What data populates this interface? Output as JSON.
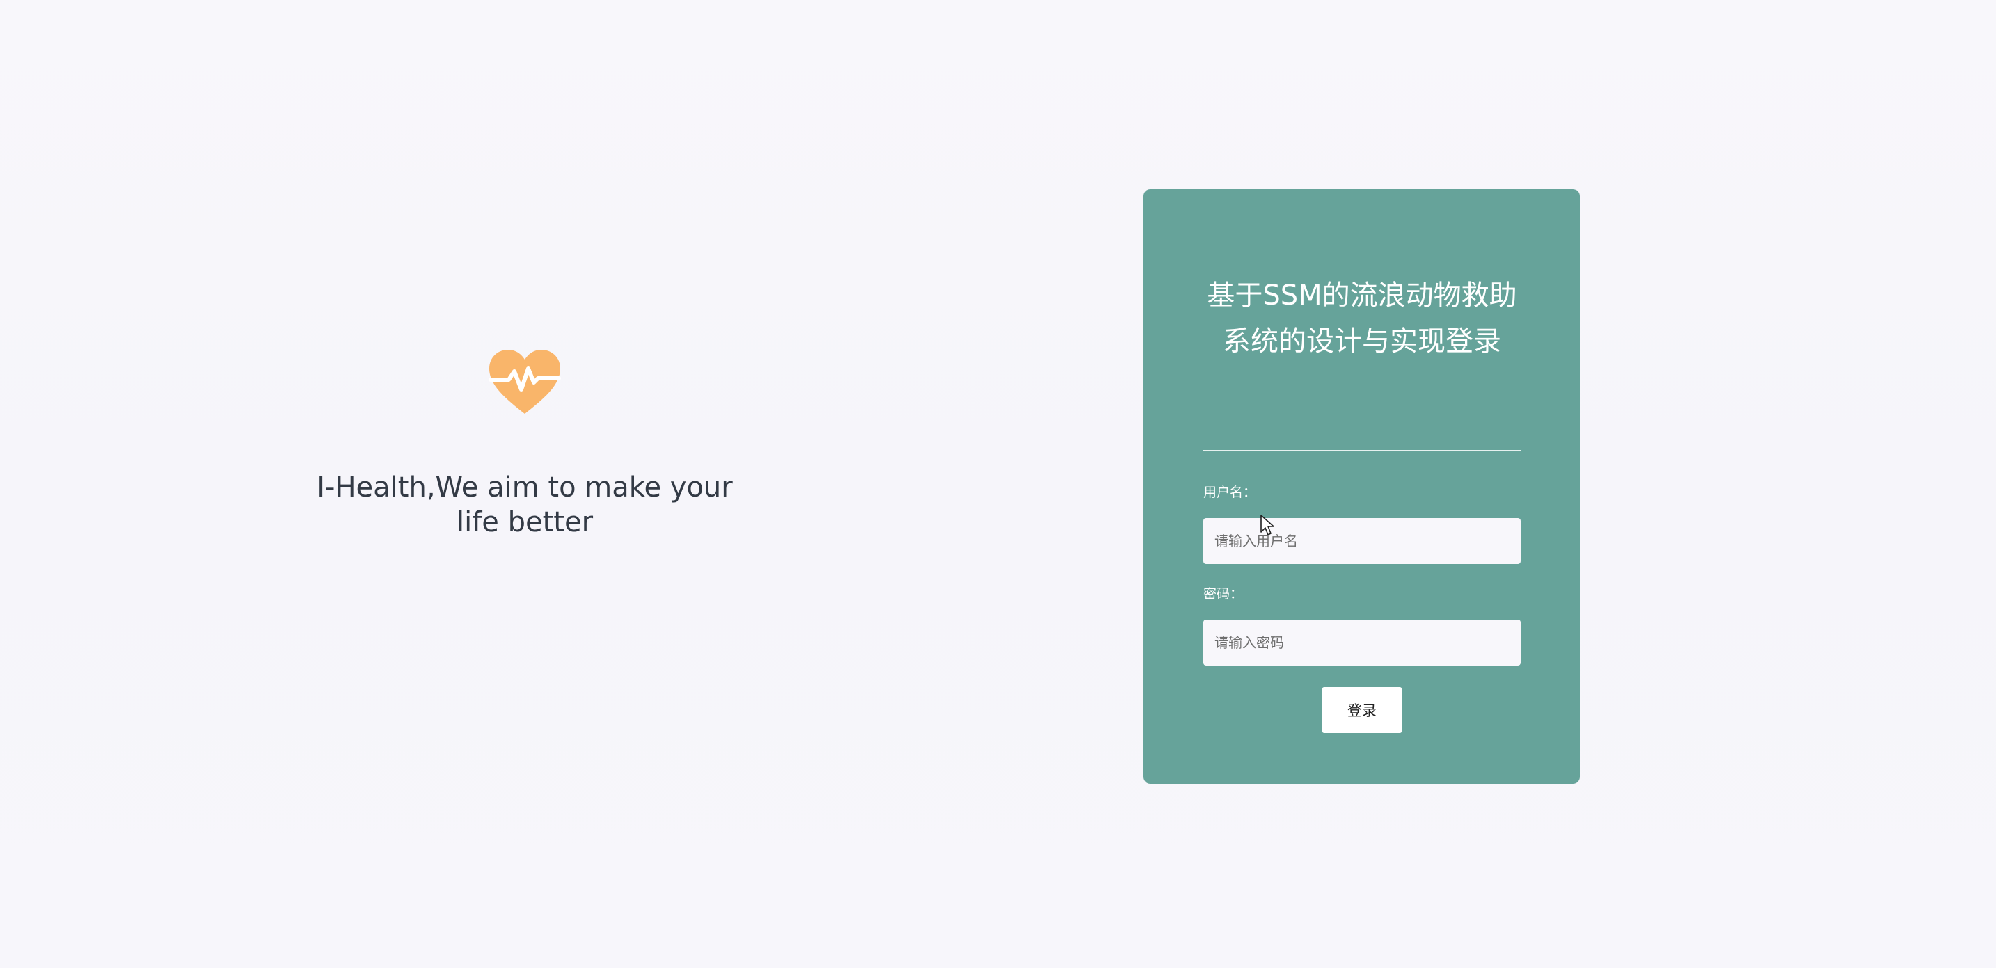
{
  "branding": {
    "icon": "heartbeat-icon",
    "icon_color": "#f9b56a",
    "tagline": "I-Health,We aim to make your life better"
  },
  "login": {
    "title": "基于SSM的流浪动物救助系统的设计与实现登录",
    "username_label": "用户名：",
    "username_placeholder": "请输入用户名",
    "username_value": "",
    "password_label": "密码：",
    "password_placeholder": "请输入密码",
    "password_value": "",
    "submit_label": "登录",
    "card_color": "#66a39a"
  },
  "cursor": {
    "icon": "mouse-pointer-icon"
  }
}
